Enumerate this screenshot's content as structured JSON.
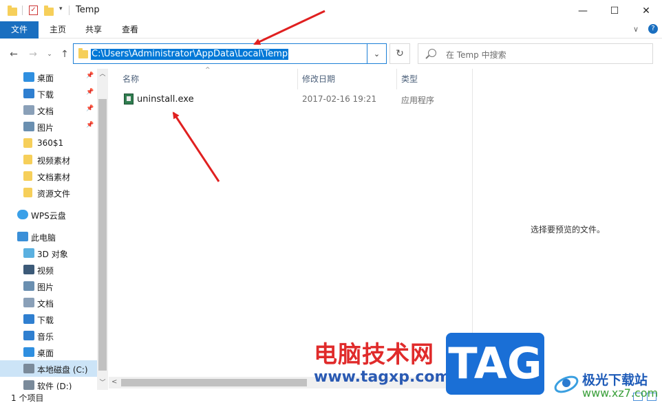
{
  "window": {
    "title": "Temp",
    "minimize": "—",
    "maximize": "☐",
    "close": "✕"
  },
  "ribbon": {
    "tabs": [
      "文件",
      "主页",
      "共享",
      "查看"
    ]
  },
  "address": {
    "path": "C:\\Users\\Administrator\\AppData\\Local\\Temp",
    "search_placeholder": "在 Temp 中搜索"
  },
  "sidebar": {
    "items": [
      {
        "label": "桌面",
        "icon": "desktop-icon",
        "pinned": true
      },
      {
        "label": "下载",
        "icon": "download-icon",
        "pinned": true
      },
      {
        "label": "文档",
        "icon": "document-icon",
        "pinned": true
      },
      {
        "label": "图片",
        "icon": "picture-icon",
        "pinned": true
      },
      {
        "label": "360$1",
        "icon": "folder-icon"
      },
      {
        "label": "视频素材",
        "icon": "folder-icon"
      },
      {
        "label": "文档素材",
        "icon": "folder-icon"
      },
      {
        "label": "资源文件",
        "icon": "folder-icon"
      },
      {
        "label": "WPS云盘",
        "icon": "cloud-icon"
      },
      {
        "label": "此电脑",
        "icon": "computer-icon"
      },
      {
        "label": "3D 对象",
        "icon": "3d-objects-icon"
      },
      {
        "label": "视频",
        "icon": "video-icon"
      },
      {
        "label": "图片",
        "icon": "picture-icon"
      },
      {
        "label": "文档",
        "icon": "document-icon"
      },
      {
        "label": "下载",
        "icon": "download-icon"
      },
      {
        "label": "音乐",
        "icon": "music-icon"
      },
      {
        "label": "桌面",
        "icon": "desktop-icon"
      },
      {
        "label": "本地磁盘 (C:)",
        "icon": "drive-icon",
        "selected": true
      },
      {
        "label": "软件 (D:)",
        "icon": "drive-icon"
      }
    ]
  },
  "columns": {
    "name": "名称",
    "date": "修改日期",
    "type": "类型"
  },
  "files": [
    {
      "name": "uninstall.exe",
      "date": "2017-02-16 19:21",
      "type": "应用程序"
    }
  ],
  "preview": {
    "text": "选择要预览的文件。"
  },
  "status": {
    "count": "1 个项目"
  },
  "watermark": {
    "cn": "电脑技术网",
    "url": "www.tagxp.com",
    "tag": "TAG",
    "site": "极光下载站",
    "site2": "www.xz7.com"
  },
  "colors": {
    "accent": "#1a6fc0",
    "selection": "#cce4f7",
    "arrow": "#e02020"
  }
}
